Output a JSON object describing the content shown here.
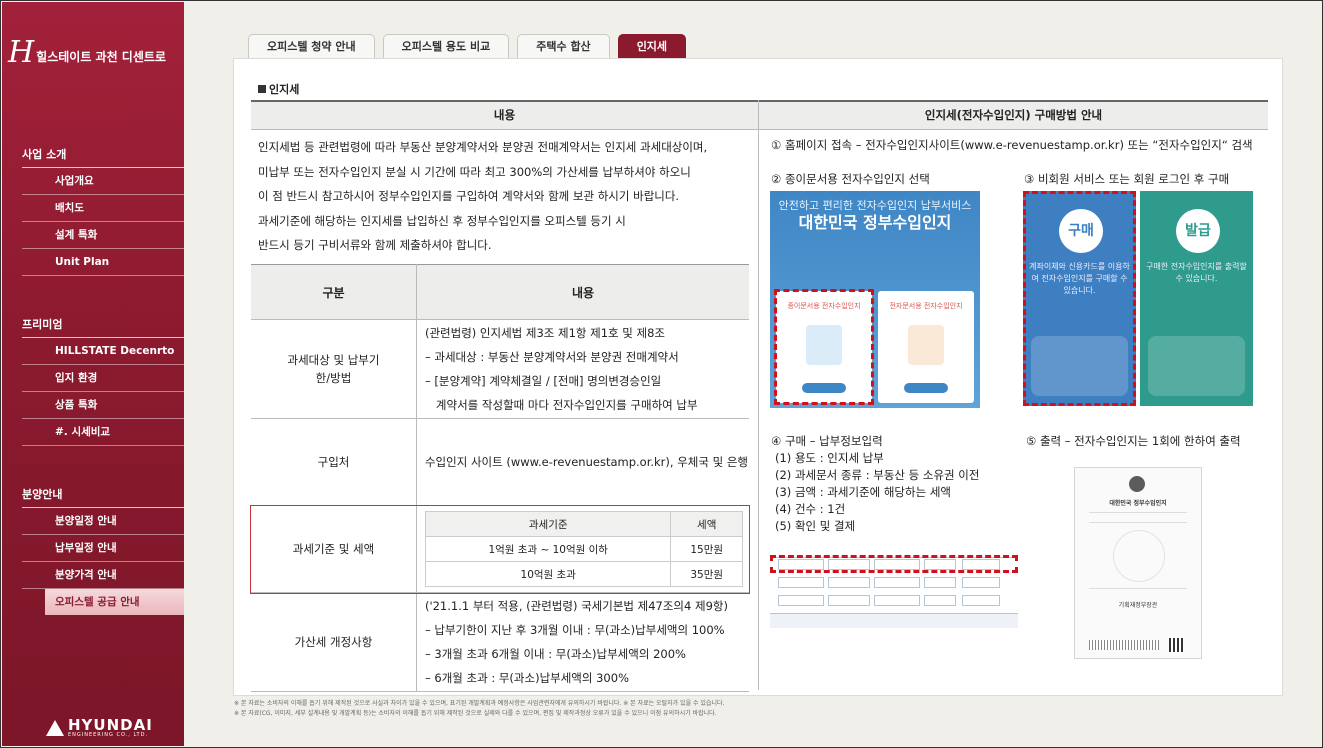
{
  "brand": {
    "logo_letter": "H",
    "logo_text": "힐스테이트 과천 디센트로"
  },
  "sidebar": {
    "sections": [
      {
        "title": "사업 소개",
        "items": [
          "사업개요",
          "배치도",
          "설계 특화",
          "Unit Plan"
        ]
      },
      {
        "title": "프리미엄",
        "items": [
          "HILLSTATE Decenrto",
          "입지 환경",
          "상품 특화",
          "#. 시세비교"
        ]
      },
      {
        "title": "분양안내",
        "items": [
          "분양일정 안내",
          "납부일정 안내",
          "분양가격 안내",
          "오피스텔 공급 안내"
        ]
      }
    ],
    "active_item": "오피스텔 공급 안내",
    "footer_logo": {
      "main": "HYUNDAI",
      "sub": "ENGINEERING CO., LTD."
    }
  },
  "tabs": [
    {
      "label": "오피스텔 청약 안내",
      "active": false
    },
    {
      "label": "오피스텔 용도 비교",
      "active": false
    },
    {
      "label": "주택수 합산",
      "active": false
    },
    {
      "label": "인지세",
      "active": true
    }
  ],
  "section_title": "인지세",
  "left": {
    "header": "내용",
    "intro": [
      "인지세법 등 관련법령에 따라 부동산 분양계약서와 분양권 전매계약서는 인지세 과세대상이며,",
      "미납부 또는 전자수입인지 분실 시 기간에 따라 최고 300%의 가산세를 납부하셔야 하오니",
      "이 점 반드시 참고하시어 정부수입인지를 구입하여 계약서와 함께 보관 하시기 바랍니다.",
      "과세기준에 해당하는 인지세를 납입하신 후 정부수입인지를 오피스텔 등기 시",
      "반드시 등기 구비서류와 함께 제출하셔야 합니다."
    ],
    "table": {
      "headers": [
        "구분",
        "내용"
      ],
      "rows": [
        {
          "label": "과세대상 및 납부기한/방법",
          "lines": [
            "(관련법령) 인지세법 제3조 제1항 제1호 및 제8조",
            "– 과세대상 : 부동산 분양계약서와 분양권 전매계약서",
            "– [분양계약] 계약체결일 / [전매] 명의변경승인일",
            "   계약서를 작성할때 마다 전자수입인지를 구매하여 납부"
          ]
        },
        {
          "label": "구입처",
          "lines": [
            "수입인지 사이트 (www.e-revenuestamp.or.kr), 우체국 및 은행"
          ]
        },
        {
          "label": "과세기준 및 세액",
          "inner": {
            "headers": [
              "과세기준",
              "세액"
            ],
            "rows": [
              [
                "1억원 초과 ~ 10억원 이하",
                "15만원"
              ],
              [
                "10억원 초과",
                "35만원"
              ]
            ]
          }
        },
        {
          "label": "가산세 개정사항",
          "lines": [
            "('21.1.1 부터 적용, (관련법령) 국세기본법 제47조의4 제9항)",
            "– 납부기한이 지난 후 3개월 이내 : 무(과소)납부세액의 100%",
            "– 3개월 초과 6개월 이내 : 무(과소)납부세액의 200%",
            "– 6개월 초과 : 무(과소)납부세액의 300%"
          ]
        }
      ]
    }
  },
  "right": {
    "header": "인지세(전자수입인지) 구매방법 안내",
    "step1": "① 홈페이지 접속 – 전자수입인지사이트(www.e-revenuestamp.or.kr) 또는 “전자수입인지“ 검색",
    "step2": "② 종이문서용 전자수입인지 선택",
    "step3": "③ 비회원 서비스 또는 회원 로그인 후 구매",
    "step4": {
      "title": "④ 구매 – 납부정보입력",
      "lines": [
        "(1) 용도 : 인지세 납부",
        "(2) 과세문서 종류 : 부동산 등 소유권 이전",
        "(3) 금액 : 과세기준에 해당하는 세액",
        "(4) 건수 : 1건",
        "(5) 확인 및 결제"
      ]
    },
    "step5": "⑤ 출력 – 전자수입인지는 1회에 한하여 출력",
    "img1": {
      "line1": "안전하고 편리한 전자수입인지 납부서비스",
      "line2": "대한민국 정부수입인지",
      "card_left": "종이문서용 전자수입인지",
      "card_right": "전자문서용 전자수입인지"
    },
    "img2": {
      "buy": "구매",
      "buy_desc": "계좌이체와 신용카드를 이용하여 전자수입인지를 구매할 수 있습니다.",
      "issue": "발급",
      "issue_desc": "구매한 전자수입인지를 출력할 수 있습니다."
    },
    "img4": {
      "title": "대한민국 정부수입인지",
      "footer": "기획재정부장관"
    },
    "colors": {
      "accent": "#8c1a2f",
      "highlight": "#d0101a",
      "blue": "#3f86c5",
      "teal": "#2f9b8c"
    }
  },
  "notes": [
    "※ 본 자료는 소비자의 이해를 돕기 위해 제작된 것으로 사실과 차이가 있을 수 있으며, 표기된 개발계획과 예정사항은 사업관련자에게 유의하시기 바랍니다.    ※ 본 자료는 오탈자가 있을 수 있습니다.",
    "※ 본 자료(CG, 이미지, 세부 설계내용 및 개발계획 등)는 소비자의 이해를 돕기 위해 제작된 것으로 실제와 다를 수 있으며, 편집 및 제작과정상 오류가 있을 수 있으니 이점 유의하시기 바랍니다."
  ]
}
